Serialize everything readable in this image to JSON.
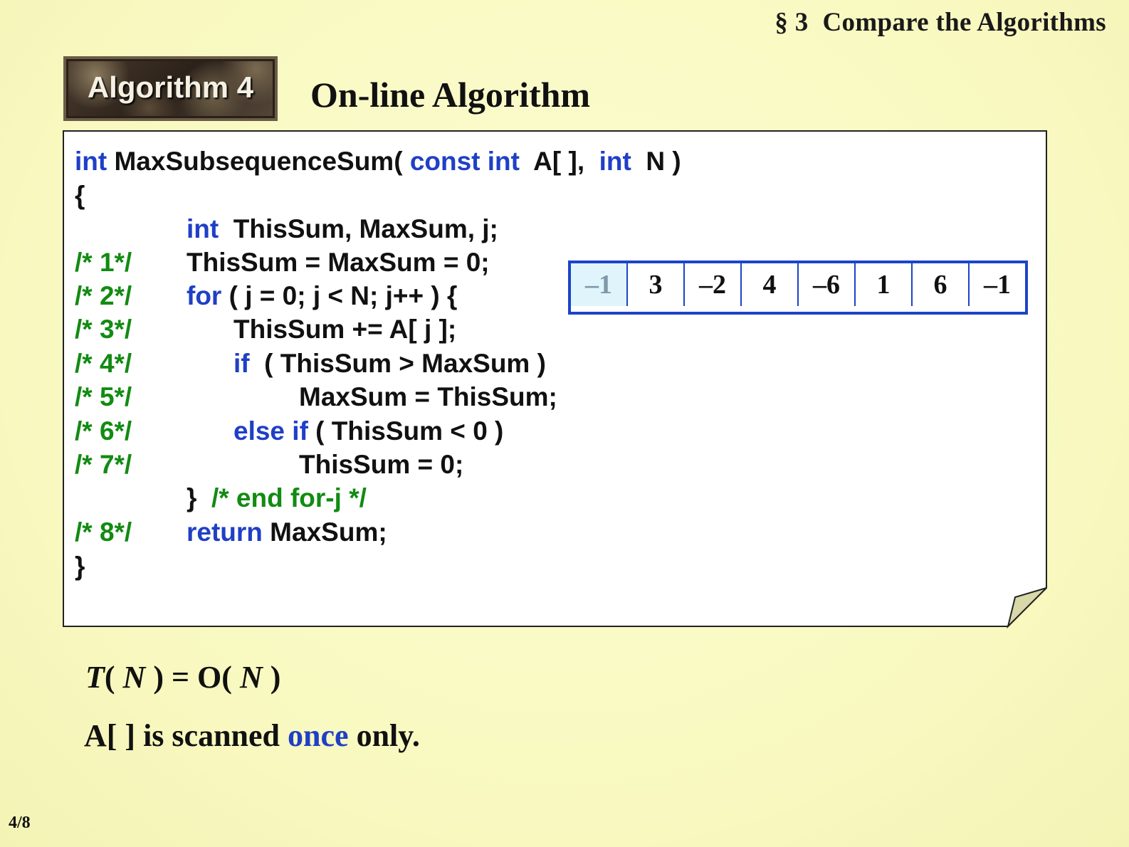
{
  "header": {
    "section_symbol": "§ 3",
    "section_title": "Compare the Algorithms"
  },
  "badge": {
    "label": "Algorithm 4"
  },
  "heading": "On-line Algorithm",
  "code": {
    "l1": {
      "kw1": "int",
      "name": " MaxSubsequenceSum( ",
      "kw2": "const int",
      "p1": "  A[ ],  ",
      "kw3": "int",
      "p2": "  N )"
    },
    "l2": "{",
    "l3": {
      "kw": "int",
      "rest": "  ThisSum, MaxSum, j;"
    },
    "l4": {
      "c": "/* 1*/",
      "rest": "ThisSum = MaxSum = 0;"
    },
    "l5": {
      "c": "/* 2*/",
      "kw": "for",
      "rest": " ( j = 0; j < N; j++ ) {"
    },
    "l6": {
      "c": "/* 3*/",
      "rest": "ThisSum += A[ j ];"
    },
    "l7": {
      "c": "/* 4*/",
      "kw": "if",
      "rest": "  ( ThisSum > MaxSum )"
    },
    "l8": {
      "c": "/* 5*/",
      "rest": "MaxSum = ThisSum;"
    },
    "l9": {
      "c": "/* 6*/",
      "kw": "else if",
      "rest": " ( ThisSum < 0 )"
    },
    "l10": {
      "c": "/* 7*/",
      "rest": "ThisSum = 0;"
    },
    "l11": {
      "brace": "}  ",
      "c": "/* end for-j */"
    },
    "l12": {
      "c": "/* 8*/",
      "kw": "return",
      "rest": " MaxSum;"
    },
    "l13": "}"
  },
  "array": [
    "–1",
    "3",
    "–2",
    "4",
    "–6",
    "1",
    "6",
    "–1"
  ],
  "complexity": {
    "T": "T",
    "open": "( ",
    "N1": "N",
    "mid": " ) = O( ",
    "N2": "N",
    "close": " )"
  },
  "note": {
    "pre": "A[ ] is scanned ",
    "hl": "once",
    "post": " only."
  },
  "page_number": "4/8",
  "colors": {
    "background": "#fafac3",
    "keyword": "#1f3fc6",
    "comment": "#128b12",
    "array_border": "#1c44c8"
  }
}
